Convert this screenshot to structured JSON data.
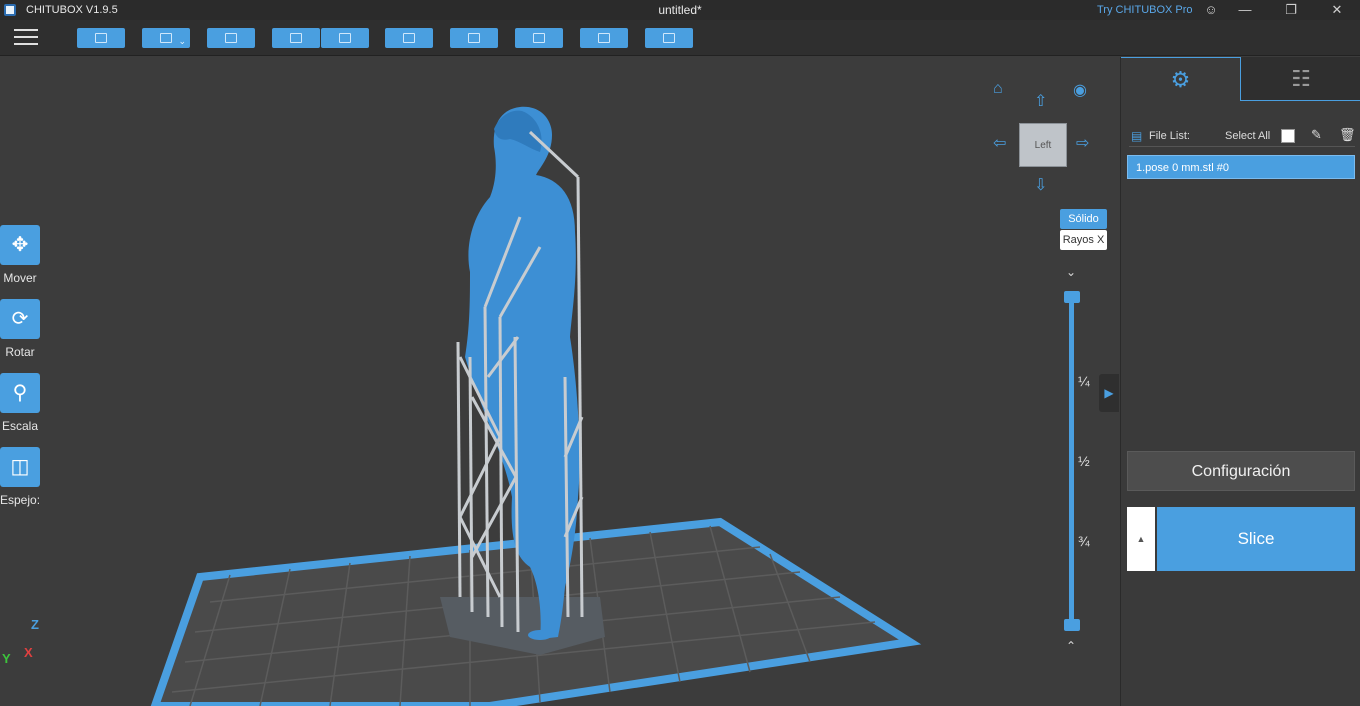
{
  "titlebar": {
    "app_name": "CHITUBOX V1.9.5",
    "document_title": "untitled*",
    "try_pro": "Try CHITUBOX Pro",
    "icons": [
      "user-icon",
      "minimize-icon",
      "restore-icon",
      "close-icon"
    ]
  },
  "toolbar": {
    "menu_icon": "hamburger-icon",
    "buttons": [
      "open-file-icon",
      "save-icon",
      "import-icon",
      "undo-icon",
      "redo-icon",
      "copy-icon",
      "arrange-icon",
      "support-icon",
      "hollow-icon",
      "print-icon"
    ]
  },
  "tools": {
    "move_label": "Mover",
    "rotate_label": "Rotar",
    "scale_label": "Escala",
    "mirror_label": "Espejo:"
  },
  "view": {
    "cube_face": "Left",
    "solid_label": "Sólido",
    "xray_label": "Rayos X",
    "quarter": "¼",
    "half": "½",
    "three_quarters": "¾",
    "axis_z": "Z",
    "axis_y": "Y",
    "axis_x": "X"
  },
  "panel": {
    "tabs": [
      "settings-icon",
      "supports-icon"
    ],
    "file_list_label": "File List:",
    "select_all_label": "Select All",
    "files": [
      "1.pose 0 mm.stl #0"
    ],
    "config_label": "Configuración",
    "slice_label": "Slice"
  },
  "colors": {
    "accent": "#4a9fe0",
    "model": "#3d8fd4",
    "support": "#c8ccd0",
    "plate_border": "#4a9fe0",
    "background": "#3c3c3c"
  }
}
